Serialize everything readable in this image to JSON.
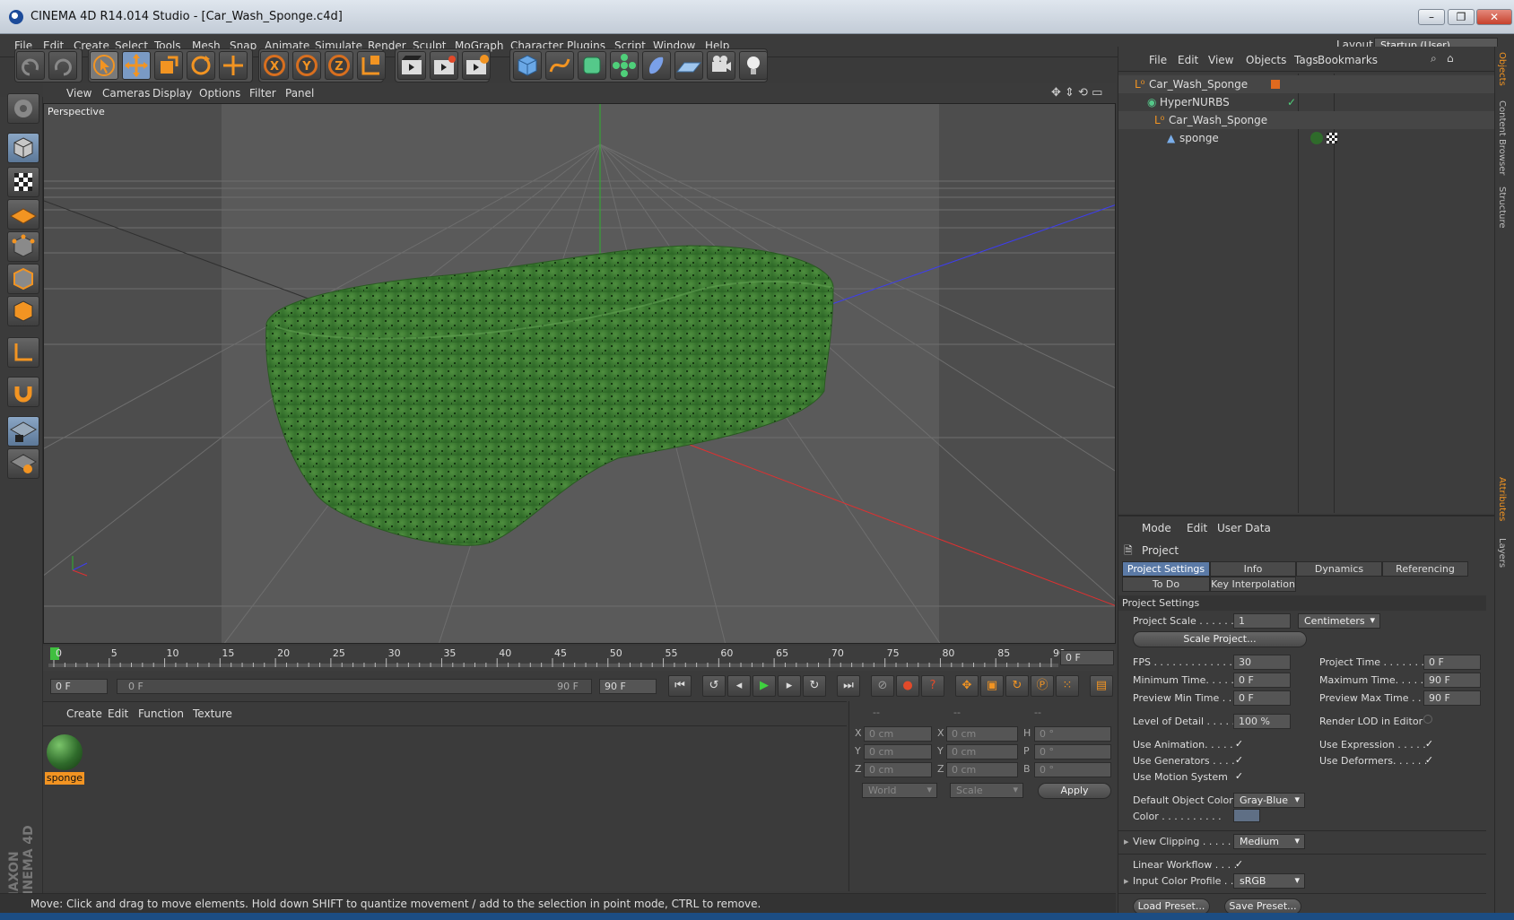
{
  "window": {
    "title": "CINEMA 4D R14.014 Studio - [Car_Wash_Sponge.c4d]",
    "min": "–",
    "max": "❐",
    "close": "✕"
  },
  "menubar": {
    "items": [
      "File",
      "Edit",
      "Create",
      "Select",
      "Tools",
      "Mesh",
      "Snap",
      "Animate",
      "Simulate",
      "Render",
      "Sculpt",
      "MoGraph",
      "Character",
      "Plugins",
      "Script",
      "Window",
      "Help"
    ],
    "layout_label": "Layout:",
    "layout_value": "Startup (User)"
  },
  "toolbar": {
    "icons": [
      "undo-icon",
      "redo-icon",
      "live-selection-icon",
      "move-icon",
      "scale-icon",
      "rotate-icon",
      "recent-tool-icon",
      "x-axis-icon",
      "y-axis-icon",
      "z-axis-icon",
      "world-coordinates-icon",
      "render-view-icon",
      "render-picture-viewer-icon",
      "render-settings-icon",
      "cube-icon",
      "spline-icon",
      "subdivision-surface-icon",
      "array-icon",
      "deformer-icon",
      "floor-icon",
      "camera-icon",
      "light-icon"
    ],
    "axis_labels": [
      "X",
      "Y",
      "Z"
    ]
  },
  "viewport": {
    "menu": [
      "View",
      "Cameras",
      "Display",
      "Options",
      "Filter",
      "Panel"
    ],
    "label": "Perspective",
    "object_color": "#3e7b33"
  },
  "timeline": {
    "ticks": [
      "0",
      "5",
      "10",
      "15",
      "20",
      "25",
      "30",
      "35",
      "40",
      "45",
      "50",
      "55",
      "60",
      "65",
      "70",
      "75",
      "80",
      "85",
      "90"
    ],
    "current_frame": "0 F",
    "start_field": "0 F",
    "range_start": "0 F",
    "range_end": "90 F",
    "end_field": "90 F"
  },
  "material_manager": {
    "menu": [
      "Create",
      "Edit",
      "Function",
      "Texture"
    ],
    "materials": [
      {
        "name": "sponge",
        "color": "#2f6b2b"
      }
    ]
  },
  "coordinates": {
    "headers": [
      "--",
      "--",
      "--"
    ],
    "rows": [
      {
        "a": "X",
        "av": "0 cm",
        "b": "X",
        "bv": "0 cm",
        "c": "H",
        "cv": "0 °"
      },
      {
        "a": "Y",
        "av": "0 cm",
        "b": "Y",
        "bv": "0 cm",
        "c": "P",
        "cv": "0 °"
      },
      {
        "a": "Z",
        "av": "0 cm",
        "b": "Z",
        "bv": "0 cm",
        "c": "B",
        "cv": "0 °"
      }
    ],
    "space": "World",
    "mode": "Scale",
    "apply": "Apply"
  },
  "status": "Move: Click and drag to move elements. Hold down SHIFT to quantize movement / add to the selection in point mode, CTRL to remove.",
  "object_manager": {
    "menu": [
      "File",
      "Edit",
      "View",
      "Objects",
      "Tags",
      "Bookmarks"
    ],
    "objects": [
      {
        "name": "Car_Wash_Sponge",
        "indent": 0
      },
      {
        "name": "HyperNURBS",
        "indent": 1
      },
      {
        "name": "Car_Wash_Sponge",
        "indent": 2
      },
      {
        "name": "sponge",
        "indent": 3
      }
    ]
  },
  "attributes": {
    "menu": [
      "Mode",
      "Edit",
      "User Data"
    ],
    "title": "Project",
    "tabs": [
      "Project Settings",
      "Info",
      "Dynamics",
      "Referencing"
    ],
    "tabs2": [
      "To Do",
      "Key Interpolation"
    ],
    "section": "Project Settings",
    "project_scale_label": "Project Scale . . . . . .",
    "project_scale_value": "1",
    "project_scale_unit": "Centimeters",
    "scale_project_btn": "Scale Project...",
    "fps_label": "FPS . . . . . . . . . . . . . .",
    "fps_value": "30",
    "project_time_label": "Project Time . . . . . . . .",
    "project_time_value": "0 F",
    "min_time_label": "Minimum Time. . . . .",
    "min_time_value": "0 F",
    "max_time_label": "Maximum Time. . . . .",
    "max_time_value": "90 F",
    "prev_min_label": "Preview Min Time . .",
    "prev_min_value": "0 F",
    "prev_max_label": "Preview Max Time . .",
    "prev_max_value": "90 F",
    "lod_label": "Level of Detail . . . . .",
    "lod_value": "100 %",
    "render_lod_label": "Render LOD in Editor",
    "use_animation_label": "Use Animation. . . . .",
    "use_expression_label": "Use Expression . . . . .",
    "use_generators_label": "Use Generators . . . .",
    "use_deformers_label": "Use Deformers. . . . . .",
    "use_motion_label": "Use Motion System",
    "default_color_label": "Default Object Color",
    "default_color_value": "Gray-Blue",
    "color_label": "Color . . . . . . . . . .",
    "color_swatch": "#5f6f85",
    "view_clipping_label": "View Clipping . . . . .",
    "view_clipping_value": "Medium",
    "linear_workflow_label": "Linear Workflow . . . .",
    "input_color_label": "Input Color Profile . .",
    "input_color_value": "sRGB",
    "load_preset": "Load Preset...",
    "save_preset": "Save Preset...",
    "check": "✓"
  },
  "side_tabs": [
    "Objects",
    "Content Browser",
    "Structure",
    "Attributes",
    "Layers"
  ]
}
